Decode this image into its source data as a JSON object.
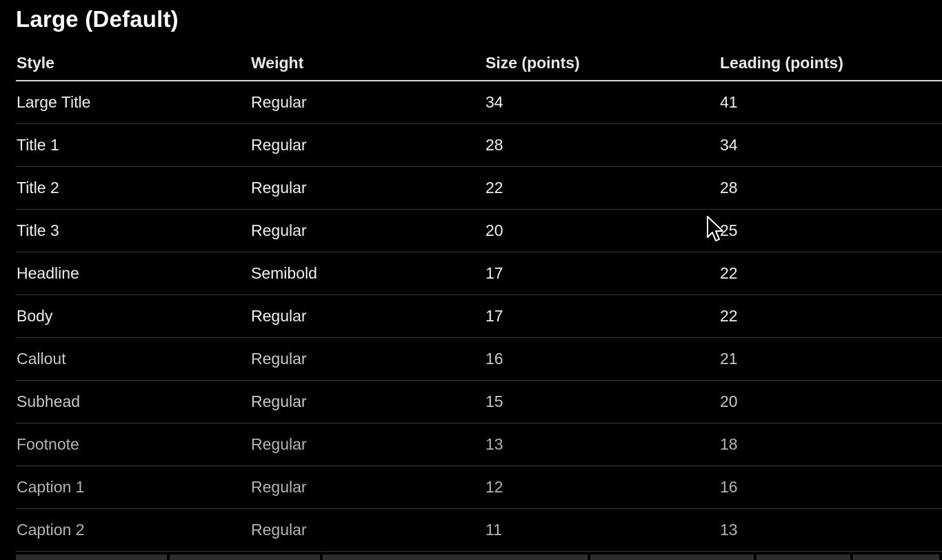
{
  "section": {
    "title": "Large (Default)"
  },
  "table": {
    "headers": [
      "Style",
      "Weight",
      "Size (points)",
      "Leading (points)"
    ],
    "rows": [
      [
        "Large Title",
        "Regular",
        "34",
        "41"
      ],
      [
        "Title 1",
        "Regular",
        "28",
        "34"
      ],
      [
        "Title 2",
        "Regular",
        "22",
        "28"
      ],
      [
        "Title 3",
        "Regular",
        "20",
        "25"
      ],
      [
        "Headline",
        "Semibold",
        "17",
        "22"
      ],
      [
        "Body",
        "Regular",
        "17",
        "22"
      ],
      [
        "Callout",
        "Regular",
        "16",
        "21"
      ],
      [
        "Subhead",
        "Regular",
        "15",
        "20"
      ],
      [
        "Footnote",
        "Regular",
        "13",
        "18"
      ],
      [
        "Caption 1",
        "Regular",
        "12",
        "16"
      ],
      [
        "Caption 2",
        "Regular",
        "11",
        "13"
      ]
    ]
  },
  "colors": {
    "background": "#000000",
    "text": "#efefef",
    "header_rule": "#d8d8d8",
    "row_divider": "#3a3a3a"
  },
  "icons": {
    "cursor": "mouse-pointer-icon"
  }
}
